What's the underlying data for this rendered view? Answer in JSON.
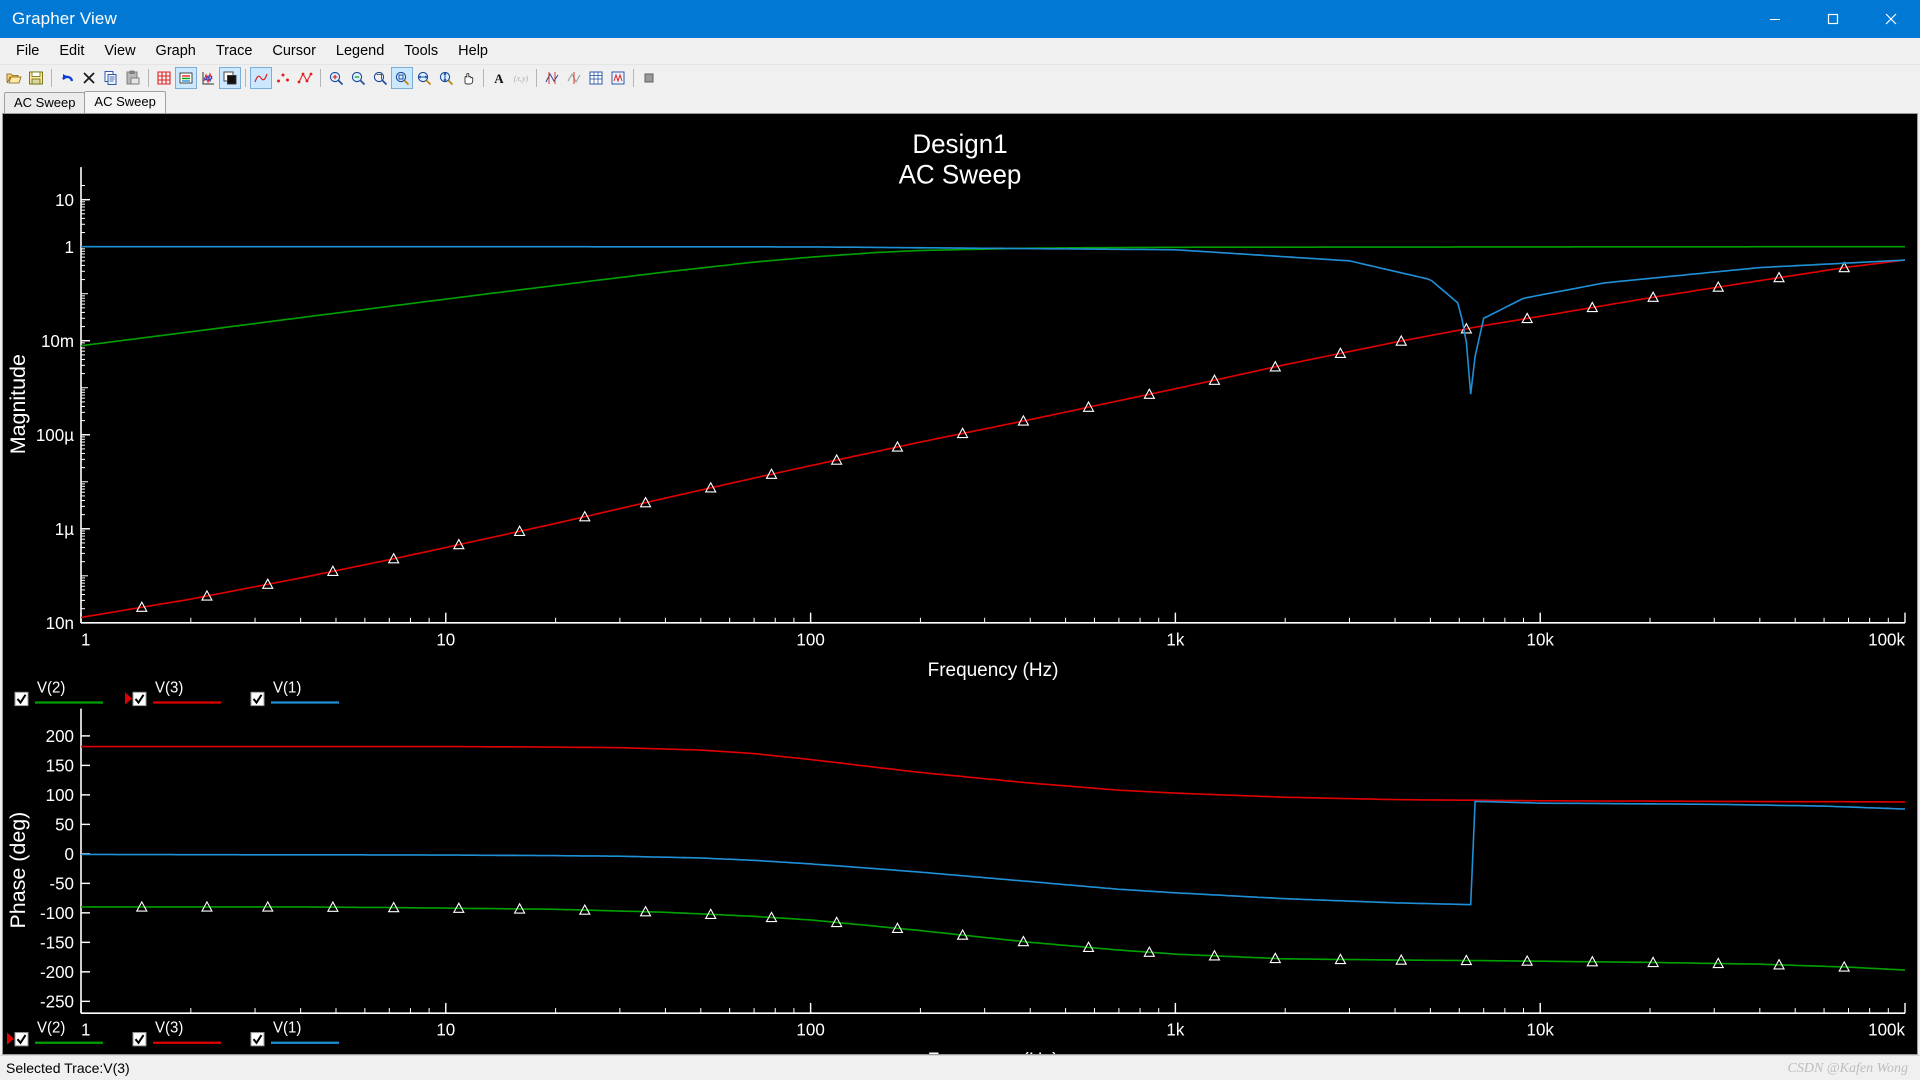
{
  "window": {
    "title": "Grapher View",
    "minimize_label": "Minimize",
    "maximize_label": "Maximize",
    "close_label": "Close"
  },
  "menu": {
    "items": [
      {
        "label": "File"
      },
      {
        "label": "Edit"
      },
      {
        "label": "View"
      },
      {
        "label": "Graph"
      },
      {
        "label": "Trace"
      },
      {
        "label": "Cursor"
      },
      {
        "label": "Legend"
      },
      {
        "label": "Tools"
      },
      {
        "label": "Help"
      }
    ]
  },
  "toolbar": {
    "buttons": [
      {
        "name": "open-icon",
        "tip": "Open"
      },
      {
        "name": "save-icon",
        "tip": "Save"
      },
      {
        "name": "undo-icon",
        "tip": "Undo"
      },
      {
        "name": "delete-icon",
        "tip": "Delete"
      },
      {
        "name": "copy-icon",
        "tip": "Copy"
      },
      {
        "name": "paste-icon",
        "tip": "Paste"
      },
      {
        "name": "grid-icon",
        "tip": "Toggle grid"
      },
      {
        "name": "legend-icon",
        "tip": "Toggle legend",
        "active": true
      },
      {
        "name": "axis-icon",
        "tip": "Toggle axes"
      },
      {
        "name": "background-icon",
        "tip": "Reverse colors",
        "active": true
      },
      {
        "name": "curve-icon",
        "tip": "Line graph",
        "active": true
      },
      {
        "name": "scatter-icon",
        "tip": "Scatter points"
      },
      {
        "name": "curve-points-icon",
        "tip": "Line with points"
      },
      {
        "name": "zoom-in-icon",
        "tip": "Zoom in"
      },
      {
        "name": "zoom-out-icon",
        "tip": "Zoom out"
      },
      {
        "name": "zoom-area-icon",
        "tip": "Zoom area"
      },
      {
        "name": "zoom-full-icon",
        "tip": "Restore zoom",
        "active": true
      },
      {
        "name": "zoom-horizontal-icon",
        "tip": "Zoom horizontal"
      },
      {
        "name": "zoom-vertical-icon",
        "tip": "Zoom vertical"
      },
      {
        "name": "pan-icon",
        "tip": "Pan"
      },
      {
        "name": "text-icon",
        "tip": "Add text"
      },
      {
        "name": "coordinates-icon",
        "tip": "Show coordinates"
      },
      {
        "name": "cursor-icon",
        "tip": "Show cursors"
      },
      {
        "name": "cursor2-icon",
        "tip": "Cursor settings"
      },
      {
        "name": "export-excel-icon",
        "tip": "Export to Excel"
      },
      {
        "name": "export-mathcad-icon",
        "tip": "Export to MathCAD"
      },
      {
        "name": "properties-icon",
        "tip": "Properties"
      }
    ]
  },
  "tabs": [
    {
      "label": "AC Sweep",
      "active": false
    },
    {
      "label": "AC Sweep",
      "active": true
    }
  ],
  "chart_data": [
    {
      "id": "magnitude",
      "type": "line",
      "title": "Design1",
      "subtitle": "AC Sweep",
      "xlabel": "Frequency (Hz)",
      "ylabel": "Magnitude",
      "xscale": "log",
      "yscale": "log",
      "xlim": [
        1,
        100000
      ],
      "ylim": [
        1e-08,
        20
      ],
      "xticks": [
        {
          "value": 1,
          "label": "1"
        },
        {
          "value": 10,
          "label": "10"
        },
        {
          "value": 100,
          "label": "100"
        },
        {
          "value": 1000,
          "label": "1k"
        },
        {
          "value": 10000,
          "label": "10k"
        },
        {
          "value": 100000,
          "label": "100k"
        }
      ],
      "yticks": [
        {
          "value": 10,
          "label": "10"
        },
        {
          "value": 1,
          "label": "1"
        },
        {
          "value": 0.01,
          "label": "10m"
        },
        {
          "value": 0.0001,
          "label": "100µ"
        },
        {
          "value": 1e-06,
          "label": "1µ"
        },
        {
          "value": 1e-08,
          "label": "10n"
        }
      ],
      "grid": false,
      "legend_position": "bottom-left",
      "series": [
        {
          "name": "V(2)",
          "color": "#00a000",
          "markers": false,
          "x": [
            1,
            2,
            4,
            7,
            10,
            20,
            40,
            70,
            100,
            150,
            200,
            400,
            700,
            1000,
            2000,
            5000,
            10000,
            30000,
            100000
          ],
          "y": [
            0.0078,
            0.0155,
            0.031,
            0.054,
            0.077,
            0.15,
            0.29,
            0.47,
            0.6,
            0.75,
            0.83,
            0.93,
            0.96,
            0.97,
            0.98,
            0.985,
            0.99,
            0.995,
            1.0
          ]
        },
        {
          "name": "V(3)",
          "color": "#e00000",
          "markers": true,
          "x": [
            1,
            2,
            4,
            7,
            10,
            20,
            40,
            70,
            100,
            200,
            400,
            700,
            1000,
            2000,
            4000,
            7000,
            10000,
            20000,
            40000,
            70000,
            100000
          ],
          "y": [
            1.3e-08,
            3.2e-08,
            9e-08,
            2.2e-07,
            4e-07,
            1.3e-06,
            4.5e-06,
            1.2e-05,
            2.2e-05,
            7e-05,
            0.00021,
            0.00053,
            0.00095,
            0.0031,
            0.0093,
            0.021,
            0.033,
            0.082,
            0.19,
            0.37,
            0.52
          ]
        },
        {
          "name": "V(1)",
          "color": "#1f8fd6",
          "markers": false,
          "notch_freq": 6500,
          "notch_depth": 0.00013,
          "x": [
            1,
            10,
            100,
            1000,
            3000,
            5000,
            6000,
            6400,
            6500,
            6600,
            7000,
            9000,
            15000,
            40000,
            100000
          ],
          "y": [
            1.0,
            1.0,
            0.99,
            0.86,
            0.5,
            0.2,
            0.06,
            0.004,
            0.00013,
            0.004,
            0.03,
            0.08,
            0.17,
            0.36,
            0.52
          ]
        }
      ]
    },
    {
      "id": "phase",
      "type": "line",
      "title": "",
      "xlabel": "Frequency (Hz)",
      "ylabel": "Phase (deg)",
      "xscale": "log",
      "yscale": "linear",
      "xlim": [
        1,
        100000
      ],
      "ylim": [
        -270,
        215
      ],
      "xticks": [
        {
          "value": 1,
          "label": "1"
        },
        {
          "value": 10,
          "label": "10"
        },
        {
          "value": 100,
          "label": "100"
        },
        {
          "value": 1000,
          "label": "1k"
        },
        {
          "value": 10000,
          "label": "10k"
        },
        {
          "value": 100000,
          "label": "100k"
        }
      ],
      "yticks": [
        {
          "value": 200,
          "label": "200"
        },
        {
          "value": 150,
          "label": "150"
        },
        {
          "value": 100,
          "label": "100"
        },
        {
          "value": 50,
          "label": "50"
        },
        {
          "value": 0,
          "label": "0"
        },
        {
          "value": -50,
          "label": "-50"
        },
        {
          "value": -100,
          "label": "-100"
        },
        {
          "value": -150,
          "label": "-150"
        },
        {
          "value": -200,
          "label": "-200"
        },
        {
          "value": -250,
          "label": "-250"
        }
      ],
      "grid": false,
      "legend_position": "bottom-left",
      "series": [
        {
          "name": "V(2)",
          "color": "#00a000",
          "markers": true,
          "x": [
            1,
            2,
            4,
            7,
            10,
            20,
            40,
            70,
            100,
            200,
            400,
            700,
            1000,
            2000,
            4000,
            7000,
            10000,
            20000,
            40000,
            70000,
            100000
          ],
          "y": [
            -90,
            -90,
            -90,
            -91,
            -92,
            -94,
            -99,
            -106,
            -112,
            -130,
            -150,
            -163,
            -170,
            -178,
            -180,
            -181,
            -182,
            -184,
            -187,
            -192,
            -197
          ]
        },
        {
          "name": "V(3)",
          "color": "#e00000",
          "markers": false,
          "x": [
            1,
            10,
            20,
            30,
            50,
            70,
            100,
            150,
            200,
            400,
            700,
            1000,
            2000,
            4000,
            6000,
            6500,
            10000,
            30000,
            100000
          ],
          "y": [
            182,
            182,
            181,
            180,
            176,
            170,
            160,
            147,
            138,
            120,
            108,
            103,
            96,
            92,
            91,
            91,
            90,
            89,
            88
          ]
        },
        {
          "name": "V(1)",
          "color": "#1f8fd6",
          "markers": false,
          "x": [
            1,
            10,
            20,
            30,
            50,
            70,
            100,
            150,
            200,
            400,
            700,
            1000,
            2000,
            4000,
            6400,
            6500,
            6600,
            10000,
            30000,
            60000,
            100000
          ],
          "y": [
            -1,
            -2,
            -3,
            -4,
            -7,
            -11,
            -17,
            -25,
            -31,
            -47,
            -60,
            -66,
            -76,
            -83,
            -86,
            90,
            89,
            86,
            84,
            81,
            76
          ]
        }
      ]
    }
  ],
  "legend": {
    "top": [
      {
        "label": "V(2)",
        "color": "#00a000",
        "checked": true,
        "selected": false
      },
      {
        "label": "V(3)",
        "color": "#e00000",
        "checked": true,
        "selected": true
      },
      {
        "label": "V(1)",
        "color": "#1f8fd6",
        "checked": true,
        "selected": false
      }
    ],
    "bottom": [
      {
        "label": "V(2)",
        "color": "#00a000",
        "checked": true,
        "selected": true
      },
      {
        "label": "V(3)",
        "color": "#e00000",
        "checked": true,
        "selected": false
      },
      {
        "label": "V(1)",
        "color": "#1f8fd6",
        "checked": true,
        "selected": false
      }
    ]
  },
  "status": {
    "text": "Selected Trace:V(3)",
    "watermark": "CSDN @Kafen Wong"
  },
  "colors": {
    "accent": "#0078d4",
    "plot_background": "#000000",
    "axis": "#ffffff",
    "trace_v1": "#1f8fd6",
    "trace_v2": "#00a000",
    "trace_v3": "#e00000"
  }
}
